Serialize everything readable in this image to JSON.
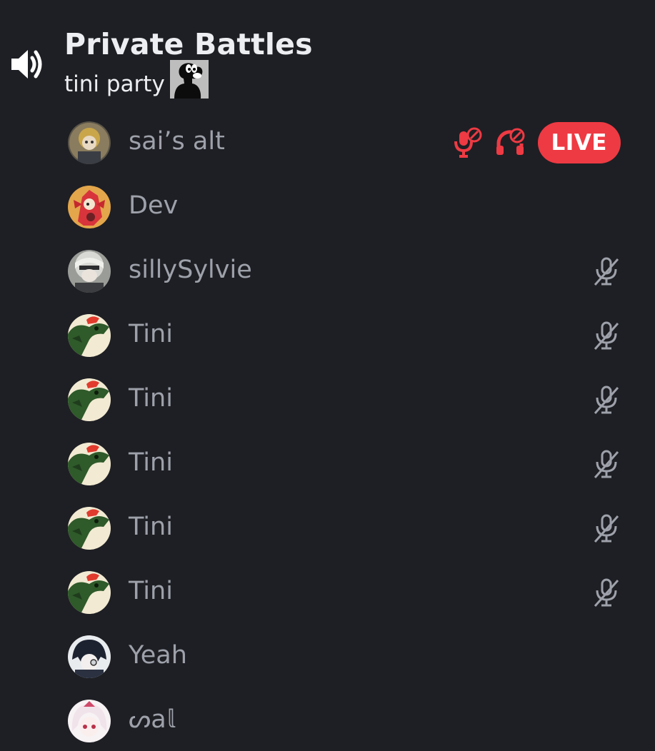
{
  "channel": {
    "name": "Private Battles",
    "status": "tini party"
  },
  "users": [
    {
      "name": "sai’s alt",
      "server_muted": true,
      "server_deafened": true,
      "live": true,
      "live_label": "LIVE",
      "muted": false
    },
    {
      "name": "Dev",
      "muted": false
    },
    {
      "name": "sillySylvie",
      "muted": true
    },
    {
      "name": "Tini",
      "muted": true
    },
    {
      "name": "Tini",
      "muted": true
    },
    {
      "name": "Tini",
      "muted": true
    },
    {
      "name": "Tini",
      "muted": true
    },
    {
      "name": "Tini",
      "muted": true
    },
    {
      "name": "Yeah",
      "muted": false
    },
    {
      "name": "ᔕa𝕝",
      "muted": false
    }
  ],
  "colors": {
    "background": "#1e1f24",
    "username": "#9ea1aa",
    "title": "#eceef1",
    "danger_red": "#ee3a43",
    "muted_icon": "#9ea1aa"
  },
  "icons": {
    "channel": "speaker-icon",
    "mute": "mic-slash-icon",
    "server_mute": "server-mute-icon",
    "server_deafen": "server-deafen-icon",
    "status_image": "black-yoshi-image"
  }
}
